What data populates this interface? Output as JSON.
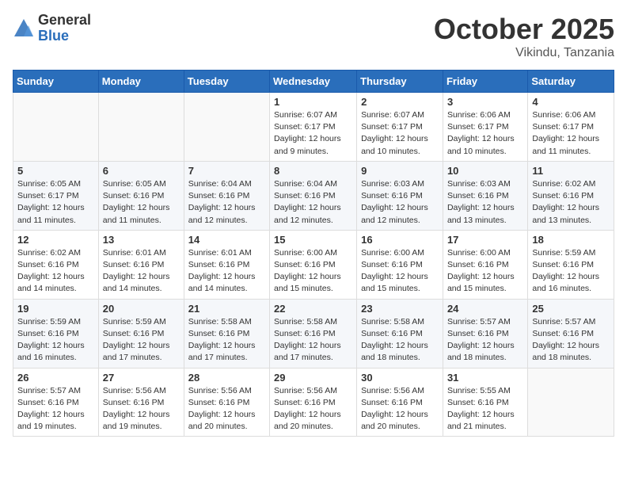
{
  "header": {
    "logo_general": "General",
    "logo_blue": "Blue",
    "month_title": "October 2025",
    "location": "Vikindu, Tanzania"
  },
  "weekdays": [
    "Sunday",
    "Monday",
    "Tuesday",
    "Wednesday",
    "Thursday",
    "Friday",
    "Saturday"
  ],
  "weeks": [
    [
      {
        "day": "",
        "detail": ""
      },
      {
        "day": "",
        "detail": ""
      },
      {
        "day": "",
        "detail": ""
      },
      {
        "day": "1",
        "detail": "Sunrise: 6:07 AM\nSunset: 6:17 PM\nDaylight: 12 hours\nand 9 minutes."
      },
      {
        "day": "2",
        "detail": "Sunrise: 6:07 AM\nSunset: 6:17 PM\nDaylight: 12 hours\nand 10 minutes."
      },
      {
        "day": "3",
        "detail": "Sunrise: 6:06 AM\nSunset: 6:17 PM\nDaylight: 12 hours\nand 10 minutes."
      },
      {
        "day": "4",
        "detail": "Sunrise: 6:06 AM\nSunset: 6:17 PM\nDaylight: 12 hours\nand 11 minutes."
      }
    ],
    [
      {
        "day": "5",
        "detail": "Sunrise: 6:05 AM\nSunset: 6:17 PM\nDaylight: 12 hours\nand 11 minutes."
      },
      {
        "day": "6",
        "detail": "Sunrise: 6:05 AM\nSunset: 6:16 PM\nDaylight: 12 hours\nand 11 minutes."
      },
      {
        "day": "7",
        "detail": "Sunrise: 6:04 AM\nSunset: 6:16 PM\nDaylight: 12 hours\nand 12 minutes."
      },
      {
        "day": "8",
        "detail": "Sunrise: 6:04 AM\nSunset: 6:16 PM\nDaylight: 12 hours\nand 12 minutes."
      },
      {
        "day": "9",
        "detail": "Sunrise: 6:03 AM\nSunset: 6:16 PM\nDaylight: 12 hours\nand 12 minutes."
      },
      {
        "day": "10",
        "detail": "Sunrise: 6:03 AM\nSunset: 6:16 PM\nDaylight: 12 hours\nand 13 minutes."
      },
      {
        "day": "11",
        "detail": "Sunrise: 6:02 AM\nSunset: 6:16 PM\nDaylight: 12 hours\nand 13 minutes."
      }
    ],
    [
      {
        "day": "12",
        "detail": "Sunrise: 6:02 AM\nSunset: 6:16 PM\nDaylight: 12 hours\nand 14 minutes."
      },
      {
        "day": "13",
        "detail": "Sunrise: 6:01 AM\nSunset: 6:16 PM\nDaylight: 12 hours\nand 14 minutes."
      },
      {
        "day": "14",
        "detail": "Sunrise: 6:01 AM\nSunset: 6:16 PM\nDaylight: 12 hours\nand 14 minutes."
      },
      {
        "day": "15",
        "detail": "Sunrise: 6:00 AM\nSunset: 6:16 PM\nDaylight: 12 hours\nand 15 minutes."
      },
      {
        "day": "16",
        "detail": "Sunrise: 6:00 AM\nSunset: 6:16 PM\nDaylight: 12 hours\nand 15 minutes."
      },
      {
        "day": "17",
        "detail": "Sunrise: 6:00 AM\nSunset: 6:16 PM\nDaylight: 12 hours\nand 15 minutes."
      },
      {
        "day": "18",
        "detail": "Sunrise: 5:59 AM\nSunset: 6:16 PM\nDaylight: 12 hours\nand 16 minutes."
      }
    ],
    [
      {
        "day": "19",
        "detail": "Sunrise: 5:59 AM\nSunset: 6:16 PM\nDaylight: 12 hours\nand 16 minutes."
      },
      {
        "day": "20",
        "detail": "Sunrise: 5:59 AM\nSunset: 6:16 PM\nDaylight: 12 hours\nand 17 minutes."
      },
      {
        "day": "21",
        "detail": "Sunrise: 5:58 AM\nSunset: 6:16 PM\nDaylight: 12 hours\nand 17 minutes."
      },
      {
        "day": "22",
        "detail": "Sunrise: 5:58 AM\nSunset: 6:16 PM\nDaylight: 12 hours\nand 17 minutes."
      },
      {
        "day": "23",
        "detail": "Sunrise: 5:58 AM\nSunset: 6:16 PM\nDaylight: 12 hours\nand 18 minutes."
      },
      {
        "day": "24",
        "detail": "Sunrise: 5:57 AM\nSunset: 6:16 PM\nDaylight: 12 hours\nand 18 minutes."
      },
      {
        "day": "25",
        "detail": "Sunrise: 5:57 AM\nSunset: 6:16 PM\nDaylight: 12 hours\nand 18 minutes."
      }
    ],
    [
      {
        "day": "26",
        "detail": "Sunrise: 5:57 AM\nSunset: 6:16 PM\nDaylight: 12 hours\nand 19 minutes."
      },
      {
        "day": "27",
        "detail": "Sunrise: 5:56 AM\nSunset: 6:16 PM\nDaylight: 12 hours\nand 19 minutes."
      },
      {
        "day": "28",
        "detail": "Sunrise: 5:56 AM\nSunset: 6:16 PM\nDaylight: 12 hours\nand 20 minutes."
      },
      {
        "day": "29",
        "detail": "Sunrise: 5:56 AM\nSunset: 6:16 PM\nDaylight: 12 hours\nand 20 minutes."
      },
      {
        "day": "30",
        "detail": "Sunrise: 5:56 AM\nSunset: 6:16 PM\nDaylight: 12 hours\nand 20 minutes."
      },
      {
        "day": "31",
        "detail": "Sunrise: 5:55 AM\nSunset: 6:16 PM\nDaylight: 12 hours\nand 21 minutes."
      },
      {
        "day": "",
        "detail": ""
      }
    ]
  ]
}
